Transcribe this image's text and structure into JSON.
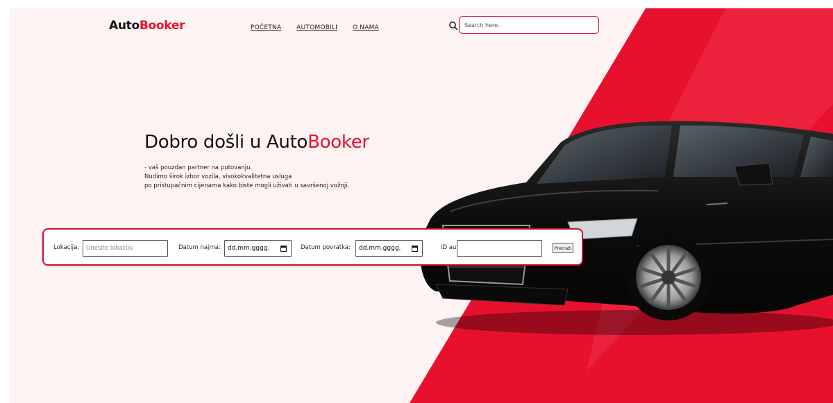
{
  "brand": {
    "prefix": "Auto",
    "suffix": "Booker",
    "accent_color": "#e8112d"
  },
  "nav": {
    "items": [
      "POČETNA",
      "AUTOMOBILI",
      "O NAMA"
    ]
  },
  "search": {
    "placeholder": "Search here.."
  },
  "hero": {
    "title_prefix": "Dobro došli u Auto",
    "title_suffix": "Booker",
    "lines": [
      "- vaš pouzdan partner na putovanju.",
      "Nudimo širok izbor vozila, visokokvalitetna usluga",
      "po pristupačnim cijenama kako biste mogli uživati u savršenoj vožnji."
    ]
  },
  "booking": {
    "location_label": "Lokacija:",
    "location_placeholder": "Unesite lokaciju",
    "rent_date_label": "Datum najma:",
    "rent_date_value": "dd.mm.gggg.",
    "return_date_label": "Datum povratka:",
    "return_date_value": "dd.mm.gggg.",
    "car_id_label": "ID auta:",
    "car_id_value": "",
    "submit_label": "Pretraži"
  },
  "colors": {
    "brand_red": "#e8112d",
    "background_pink": "#fdf3f3",
    "border_red": "#c8122a"
  }
}
